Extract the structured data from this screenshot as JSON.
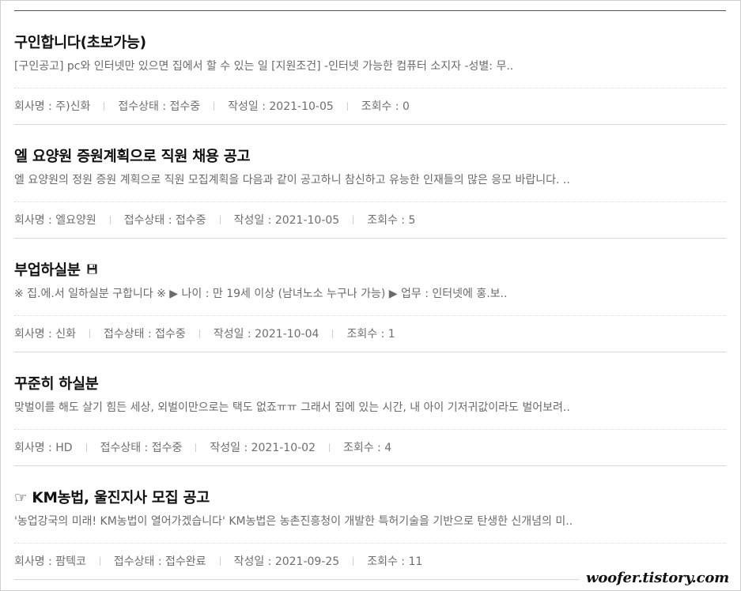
{
  "posts": [
    {
      "title": "구인합니다(초보가능)",
      "icon": "",
      "summary": "[구인공고] pc와 인터넷만 있으면 집에서 할 수 있는 일 [지원조건] -인터넷 가능한 컴퓨터 소지자 -성별: 무..",
      "company": "회사명 : 주)신화",
      "status": "접수상태 : 접수중",
      "date": "작성일 : 2021-10-05",
      "views": "조회수 : 0"
    },
    {
      "title": "엘 요양원 증원계획으로 직원 채용 공고",
      "icon": "",
      "summary": "엘 요양원의 정원 증원 계획으로 직원 모집계획을 다음과 같이 공고하니 참신하고 유능한 인재들의 많은 응모 바랍니다. ..",
      "company": "회사명 : 엘요양원",
      "status": "접수상태 : 접수중",
      "date": "작성일 : 2021-10-05",
      "views": "조회수 : 5"
    },
    {
      "title": "부업하실분",
      "icon": "floppy-disk",
      "summary": "※ 집.에.서 일하실분 구합니다 ※ ▶ 나이 : 만 19세 이상 (남녀노소 누구나 가능) ▶ 업무 : 인터넷에 홍.보..",
      "company": "회사명 : 신화",
      "status": "접수상태 : 접수중",
      "date": "작성일 : 2021-10-04",
      "views": "조회수 : 1"
    },
    {
      "title": "꾸준히 하실분",
      "icon": "",
      "summary": "맞벌이를 해도 살기 힘든 세상, 외벌이만으로는 택도 없죠ㅠㅠ 그래서 집에 있는 시간, 내 아이 기저귀값이라도 벌어보려..",
      "company": "회사명 : HD",
      "status": "접수상태 : 접수중",
      "date": "작성일 : 2021-10-02",
      "views": "조회수 : 4"
    },
    {
      "title": "☞ KM농법, 울진지사 모집 공고",
      "icon": "",
      "summary": "'농업강국의 미래! KM농법이 열어가겠습니다' KM농법은 농촌진흥청이 개발한 특허기술을 기반으로 탄생한 신개념의 미..",
      "company": "회사명 : 팜텍코",
      "status": "접수상태 : 접수완료",
      "date": "작성일 : 2021-09-25",
      "views": "조회수 : 11"
    }
  ],
  "watermark": "woofer.tistory.com"
}
